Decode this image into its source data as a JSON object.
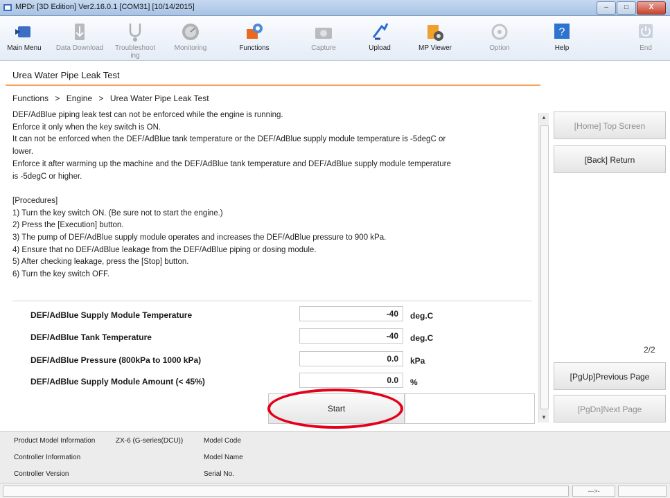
{
  "window": {
    "title": "MPDr [3D Edition] Ver2.16.0.1 [COM31] [10/14/2015]",
    "minimize": "–",
    "maximize": "□",
    "close": "X"
  },
  "toolbar": [
    {
      "label": "Main Menu",
      "icon": "main-menu-icon",
      "enabled": true
    },
    {
      "label": "Data Download",
      "icon": "data-download-icon",
      "enabled": false
    },
    {
      "label": "Troubleshoot ing",
      "icon": "stethoscope-icon",
      "enabled": false
    },
    {
      "label": "Monitoring",
      "icon": "monitoring-gauge-icon",
      "enabled": false
    },
    {
      "label": "Functions",
      "icon": "functions-icon",
      "enabled": true
    },
    {
      "label": "Capture",
      "icon": "capture-icon",
      "enabled": false
    },
    {
      "label": "Upload",
      "icon": "upload-icon",
      "enabled": true
    },
    {
      "label": "MP Viewer",
      "icon": "mp-viewer-icon",
      "enabled": true
    },
    {
      "label": "Option",
      "icon": "option-icon",
      "enabled": false
    },
    {
      "label": "Help",
      "icon": "help-icon",
      "enabled": true
    },
    {
      "label": "End",
      "icon": "power-icon",
      "enabled": false
    }
  ],
  "page": {
    "title": "Urea Water Pipe Leak Test",
    "breadcrumb": [
      "Functions",
      ">",
      "Engine",
      ">",
      "Urea Water Pipe Leak Test"
    ]
  },
  "instructions": [
    "DEF/AdBlue piping leak test can not be enforced while the engine is running.",
    "Enforce it only when the key switch is ON.",
    "It can not be enforced when the DEF/AdBlue tank temperature or the DEF/AdBlue supply module temperature is -5degC or",
    "lower.",
    "Enforce it after warming up the machine and the DEF/AdBlue tank temperature and DEF/AdBlue supply module temperature",
    "is -5degC or higher.",
    "",
    "[Procedures]",
    "1) Turn the key switch ON. (Be sure not to start the engine.)",
    "2) Press the [Execution] button.",
    "3) The pump of DEF/AdBlue supply module operates and increases the DEF/AdBlue pressure to 900 kPa.",
    "4) Ensure that no DEF/AdBlue leakage from the DEF/AdBlue piping or dosing module.",
    "5) After checking leakage, press the [Stop] button.",
    "6) Turn the key switch OFF."
  ],
  "readings": [
    {
      "label": "DEF/AdBlue Supply Module Temperature",
      "value": "-40",
      "unit": "deg.C"
    },
    {
      "label": "DEF/AdBlue Tank Temperature",
      "value": "-40",
      "unit": "deg.C"
    },
    {
      "label": "DEF/AdBlue Pressure (800kPa to 1000 kPa)",
      "value": "0.0",
      "unit": "kPa"
    },
    {
      "label": "DEF/AdBlue Supply Module Amount (< 45%)",
      "value": "0.0",
      "unit": "%"
    }
  ],
  "start_button": "Start",
  "side": {
    "home": "[Home] Top Screen",
    "back": "[Back] Return",
    "page_indicator": "2/2",
    "prev": "[PgUp]Previous Page",
    "next": "[PgDn]Next Page"
  },
  "info": {
    "product_model_label": "Product Model Information",
    "product_model_value": "ZX-6 (G-series(DCU))",
    "controller_info_label": "Controller Information",
    "controller_version_label": "Controller Version",
    "model_code_label": "Model Code",
    "model_name_label": "Model Name",
    "serial_no_label": "Serial No."
  },
  "status": {
    "indicator": "--->-"
  },
  "colors": {
    "accent_underline": "#f2a25b",
    "highlight_circle": "#e3001b"
  }
}
